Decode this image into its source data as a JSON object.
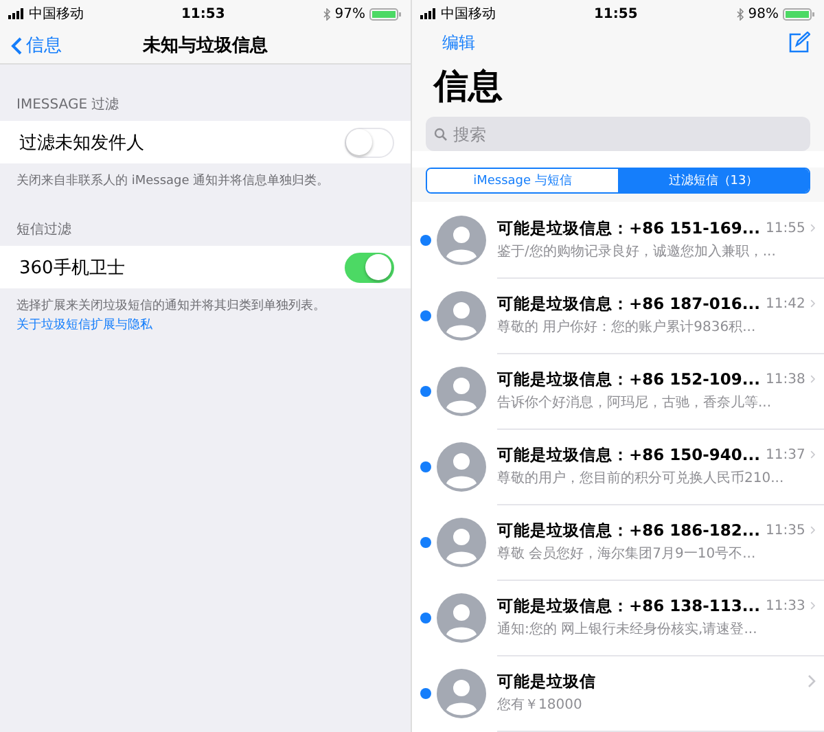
{
  "left_screen": {
    "status_bar": {
      "carrier": "中国移动",
      "time": "11:53",
      "battery": "97%"
    },
    "nav": {
      "back": "信息",
      "title": "未知与垃圾信息"
    },
    "sections": [
      {
        "header": "IMESSAGE 过滤",
        "row": {
          "label": "过滤未知发件人",
          "on": false
        },
        "footer": "关闭来自非联系人的 iMessage 通知并将信息单独归类。"
      },
      {
        "header": "短信过滤",
        "row": {
          "label": "360手机卫士",
          "on": true
        },
        "footer": "选择扩展来关闭垃圾短信的通知并将其归类到单独列表。",
        "link": "关于垃圾短信扩展与隐私"
      }
    ]
  },
  "right_screen": {
    "status_bar": {
      "carrier": "中国移动",
      "time": "11:55",
      "battery": "98%"
    },
    "edit": "编辑",
    "title": "信息",
    "search": {
      "placeholder": "搜索"
    },
    "segments": [
      {
        "label": "iMessage 与短信",
        "selected": false
      },
      {
        "label": "过滤短信（13）",
        "selected": true
      }
    ],
    "messages": [
      {
        "title": "可能是垃圾信息：+86 151-169...",
        "time": "11:55",
        "preview": "鉴于/您的购物记录良好，诚邀您加入兼职，...",
        "unread": true
      },
      {
        "title": "可能是垃圾信息：+86 187-016...",
        "time": "11:42",
        "preview": "尊敬的 用户你好：您的账户累计9836积...",
        "unread": true
      },
      {
        "title": "可能是垃圾信息：+86 152-109...",
        "time": "11:38",
        "preview": "告诉你个好消息，阿玛尼，古驰，香奈儿等...",
        "unread": true
      },
      {
        "title": "可能是垃圾信息：+86 150-940...",
        "time": "11:37",
        "preview": "尊敬的用户，您目前的积分可兑换人民币210...",
        "unread": true
      },
      {
        "title": "可能是垃圾信息：+86 186-182...",
        "time": "11:35",
        "preview": "尊敬 会员您好，海尔集团7月9一10号不...",
        "unread": true
      },
      {
        "title": "可能是垃圾信息：+86 138-113...",
        "time": "11:33",
        "preview": "通知:您的 网上银行未经身份核实,请速登...",
        "unread": true
      },
      {
        "title": "可能是垃圾信",
        "preview": "您有￥18000",
        "unread": true
      }
    ]
  }
}
